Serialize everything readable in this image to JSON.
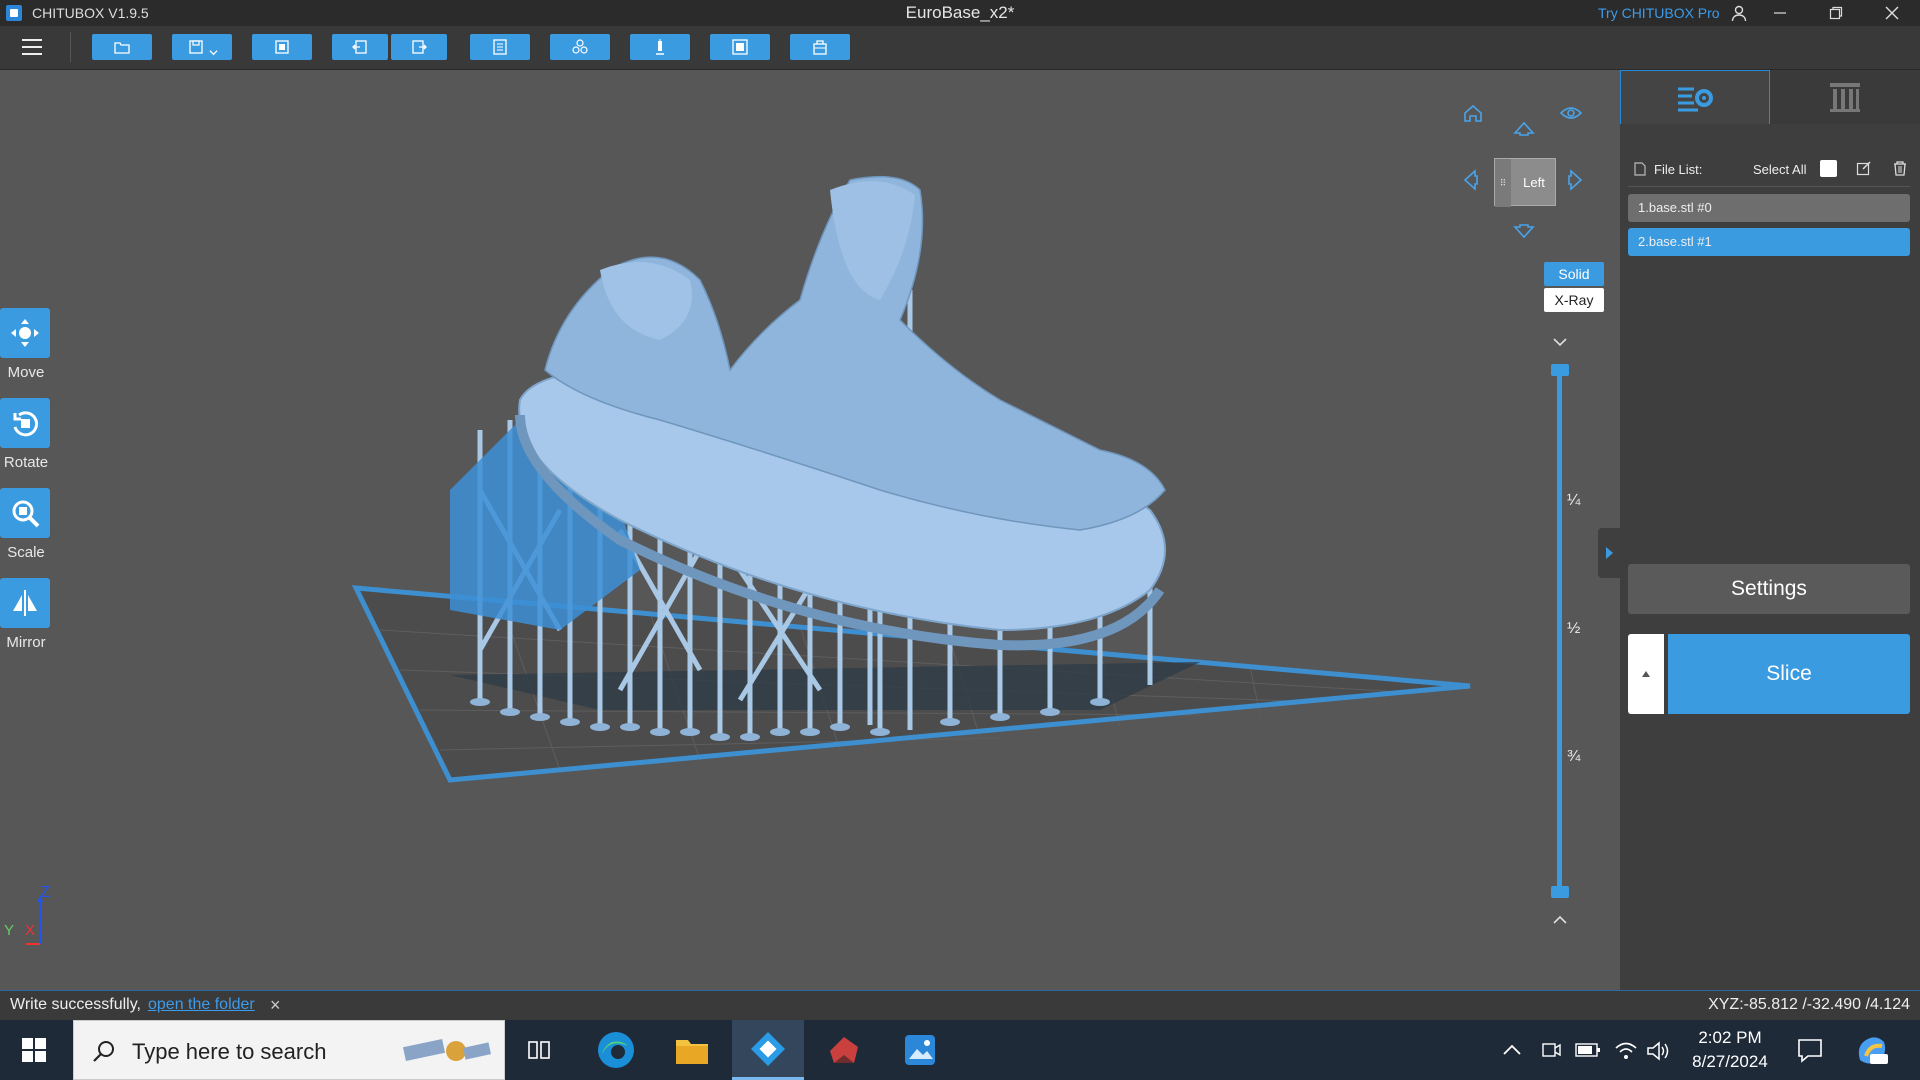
{
  "titlebar": {
    "app_name": "CHITUBOX V1.9.5",
    "doc_title": "EuroBase_x2*",
    "try_pro": "Try CHITUBOX Pro"
  },
  "toolbar": {
    "buttons": [
      "open-file",
      "save",
      "open-model",
      "undo",
      "redo",
      "layout",
      "copy",
      "support",
      "hollow",
      "dig-hole"
    ]
  },
  "left_tools": [
    {
      "label": "Move",
      "icon": "move-icon"
    },
    {
      "label": "Rotate",
      "icon": "rotate-icon"
    },
    {
      "label": "Scale",
      "icon": "scale-icon"
    },
    {
      "label": "Mirror",
      "icon": "mirror-icon"
    }
  ],
  "view_cube": {
    "face_label": "Left"
  },
  "render_mode": {
    "solid": "Solid",
    "xray": "X-Ray"
  },
  "layer_slider": {
    "marks": [
      "¼",
      "½",
      "¾"
    ]
  },
  "axis": {
    "z": "Z",
    "y": "Y",
    "x": "X"
  },
  "right_panel": {
    "file_list_label": "File List:",
    "select_all": "Select All",
    "files": [
      "1.base.stl #0",
      "2.base.stl #1"
    ],
    "settings_label": "Settings",
    "slice_label": "Slice"
  },
  "statusbar": {
    "message": "Write successfully,",
    "link": "open the folder",
    "close": "×",
    "coords": "XYZ:-85.812 /-32.490 /4.124"
  },
  "taskbar": {
    "search_placeholder": "Type here to search",
    "time": "2:02 PM",
    "date": "8/27/2024"
  },
  "colors": {
    "accent": "#3b9be0",
    "model": "#9fc4e8",
    "viewport": "#575757"
  }
}
